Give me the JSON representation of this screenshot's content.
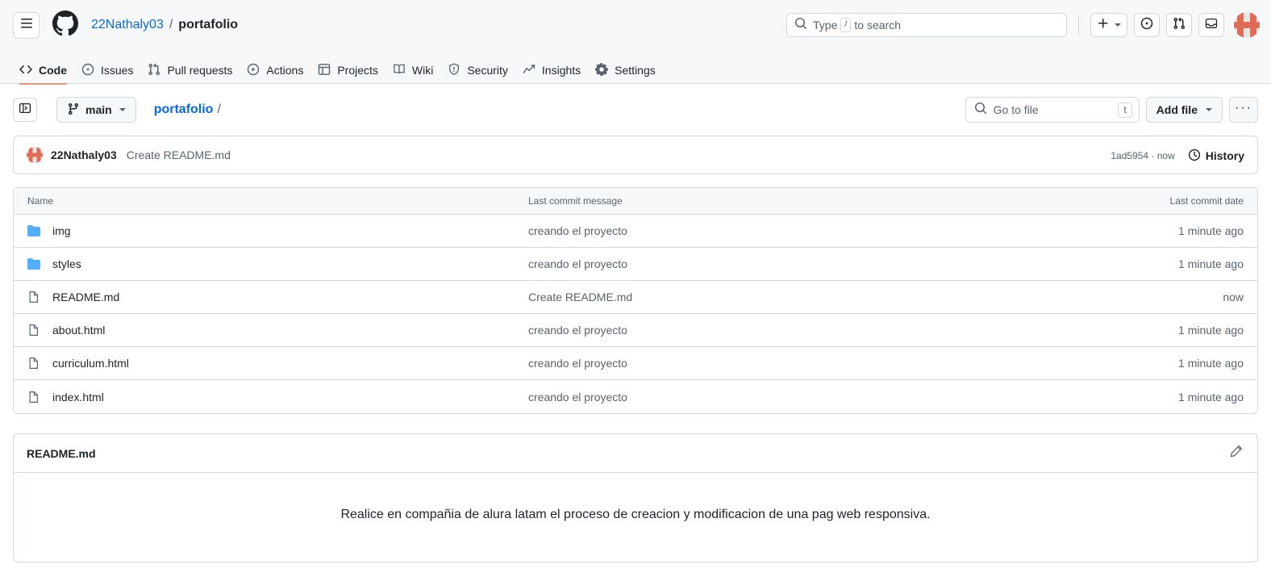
{
  "header": {
    "menu_icon": "hamburger-icon",
    "logo_icon": "github-mark-icon",
    "owner": "22Nathaly03",
    "separator": "/",
    "repo": "portafolio",
    "search": {
      "icon": "search-icon",
      "placeholder_prefix": "Type",
      "key": "/",
      "placeholder_suffix": "to search"
    },
    "actions": [
      {
        "name": "create-new-button",
        "icon": "plus-icon"
      },
      {
        "name": "issues-button",
        "icon": "issue-opened-icon"
      },
      {
        "name": "pull-requests-button",
        "icon": "git-pull-request-icon"
      },
      {
        "name": "inbox-button",
        "icon": "inbox-icon"
      }
    ],
    "avatar_label": "22Nathaly03"
  },
  "nav": {
    "tabs": [
      {
        "label": "Code",
        "icon": "code-icon",
        "active": true
      },
      {
        "label": "Issues",
        "icon": "issue-opened-icon",
        "active": false
      },
      {
        "label": "Pull requests",
        "icon": "git-pull-request-icon",
        "active": false
      },
      {
        "label": "Actions",
        "icon": "play-icon",
        "active": false
      },
      {
        "label": "Projects",
        "icon": "table-icon",
        "active": false
      },
      {
        "label": "Wiki",
        "icon": "book-icon",
        "active": false
      },
      {
        "label": "Security",
        "icon": "shield-icon",
        "active": false
      },
      {
        "label": "Insights",
        "icon": "graph-icon",
        "active": false
      },
      {
        "label": "Settings",
        "icon": "gear-icon",
        "active": false
      }
    ]
  },
  "toolbar": {
    "sidebar_toggle_icon": "sidebar-expand-icon",
    "branch": "main",
    "branch_icon": "git-branch-icon",
    "breadcrumb_repo": "portafolio",
    "breadcrumb_sep": "/",
    "go_to_file_placeholder": "Go to file",
    "go_to_file_key": "t",
    "add_file_label": "Add file",
    "kebab_label": "···"
  },
  "commit_bar": {
    "author": "22Nathaly03",
    "message": "Create README.md",
    "sha_and_time": "1ad5954 · now",
    "history_label": "History",
    "history_icon": "history-icon"
  },
  "file_table": {
    "columns": [
      "Name",
      "Last commit message",
      "Last commit date"
    ],
    "rows": [
      {
        "icon": "folder-icon",
        "type": "folder",
        "name": "img",
        "message": "creando el proyecto",
        "date": "1 minute ago"
      },
      {
        "icon": "folder-icon",
        "type": "folder",
        "name": "styles",
        "message": "creando el proyecto",
        "date": "1 minute ago"
      },
      {
        "icon": "file-icon",
        "type": "file",
        "name": "README.md",
        "message": "Create README.md",
        "date": "now"
      },
      {
        "icon": "file-icon",
        "type": "file",
        "name": "about.html",
        "message": "creando el proyecto",
        "date": "1 minute ago"
      },
      {
        "icon": "file-icon",
        "type": "file",
        "name": "curriculum.html",
        "message": "creando el proyecto",
        "date": "1 minute ago"
      },
      {
        "icon": "file-icon",
        "type": "file",
        "name": "index.html",
        "message": "creando el proyecto",
        "date": "1 minute ago"
      }
    ]
  },
  "readme": {
    "title": "README.md",
    "edit_icon": "pencil-icon",
    "body": "Realice en compañia de alura latam el proceso de creacion y modificacion de una pag web responsiva."
  },
  "colors": {
    "accent": "#0969da",
    "active_tab_underline": "#fd8c73",
    "folder_blue": "#54aeff",
    "header_bg": "#f6f8fa",
    "border": "#d1d9e0",
    "muted_text": "#59636e",
    "avatar_coral": "#e06b56"
  }
}
